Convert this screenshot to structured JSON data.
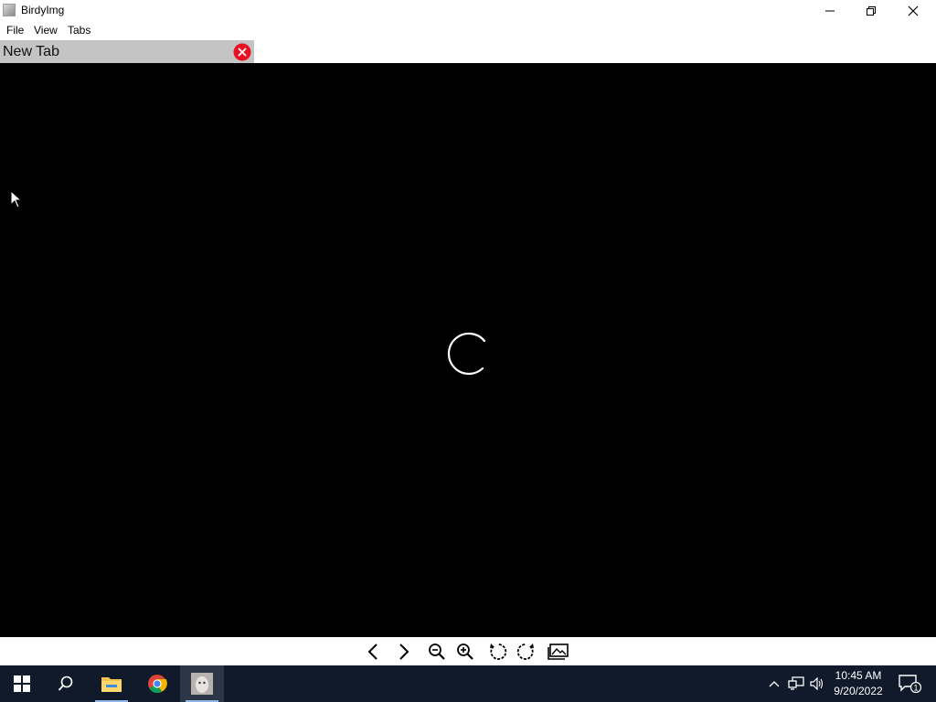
{
  "window": {
    "title": "BirdyImg",
    "icon": "app-icon",
    "controls": [
      "minimize-icon",
      "restore-icon",
      "close-icon"
    ]
  },
  "menu": {
    "file": "File",
    "view": "View",
    "tabs": "Tabs"
  },
  "tabs": [
    {
      "label": "New Tab",
      "active": true,
      "close_icon": "tab-close-icon"
    }
  ],
  "viewer": {
    "background": "#000000",
    "state_icon": "loading-spinner-icon"
  },
  "toolbar": {
    "buttons": [
      "previous-icon",
      "next-icon",
      "zoom-out-icon",
      "zoom-in-icon",
      "rotate-left-icon",
      "rotate-right-icon",
      "open-gallery-icon"
    ]
  },
  "taskbar": {
    "apps": [
      "start-icon",
      "search-icon",
      "file-explorer-icon",
      "chrome-icon",
      "birdyimg-icon"
    ],
    "tray": [
      "show-hidden-icons-icon",
      "network-icon",
      "volume-icon"
    ],
    "time": "10:45 AM",
    "date": "9/20/2022",
    "notifications": "1"
  },
  "colors": {
    "tab_bg": "#c4c4c4",
    "tab_close": "#e81123",
    "taskbar_bg": "#101a2a",
    "viewer_bg": "#000000"
  }
}
